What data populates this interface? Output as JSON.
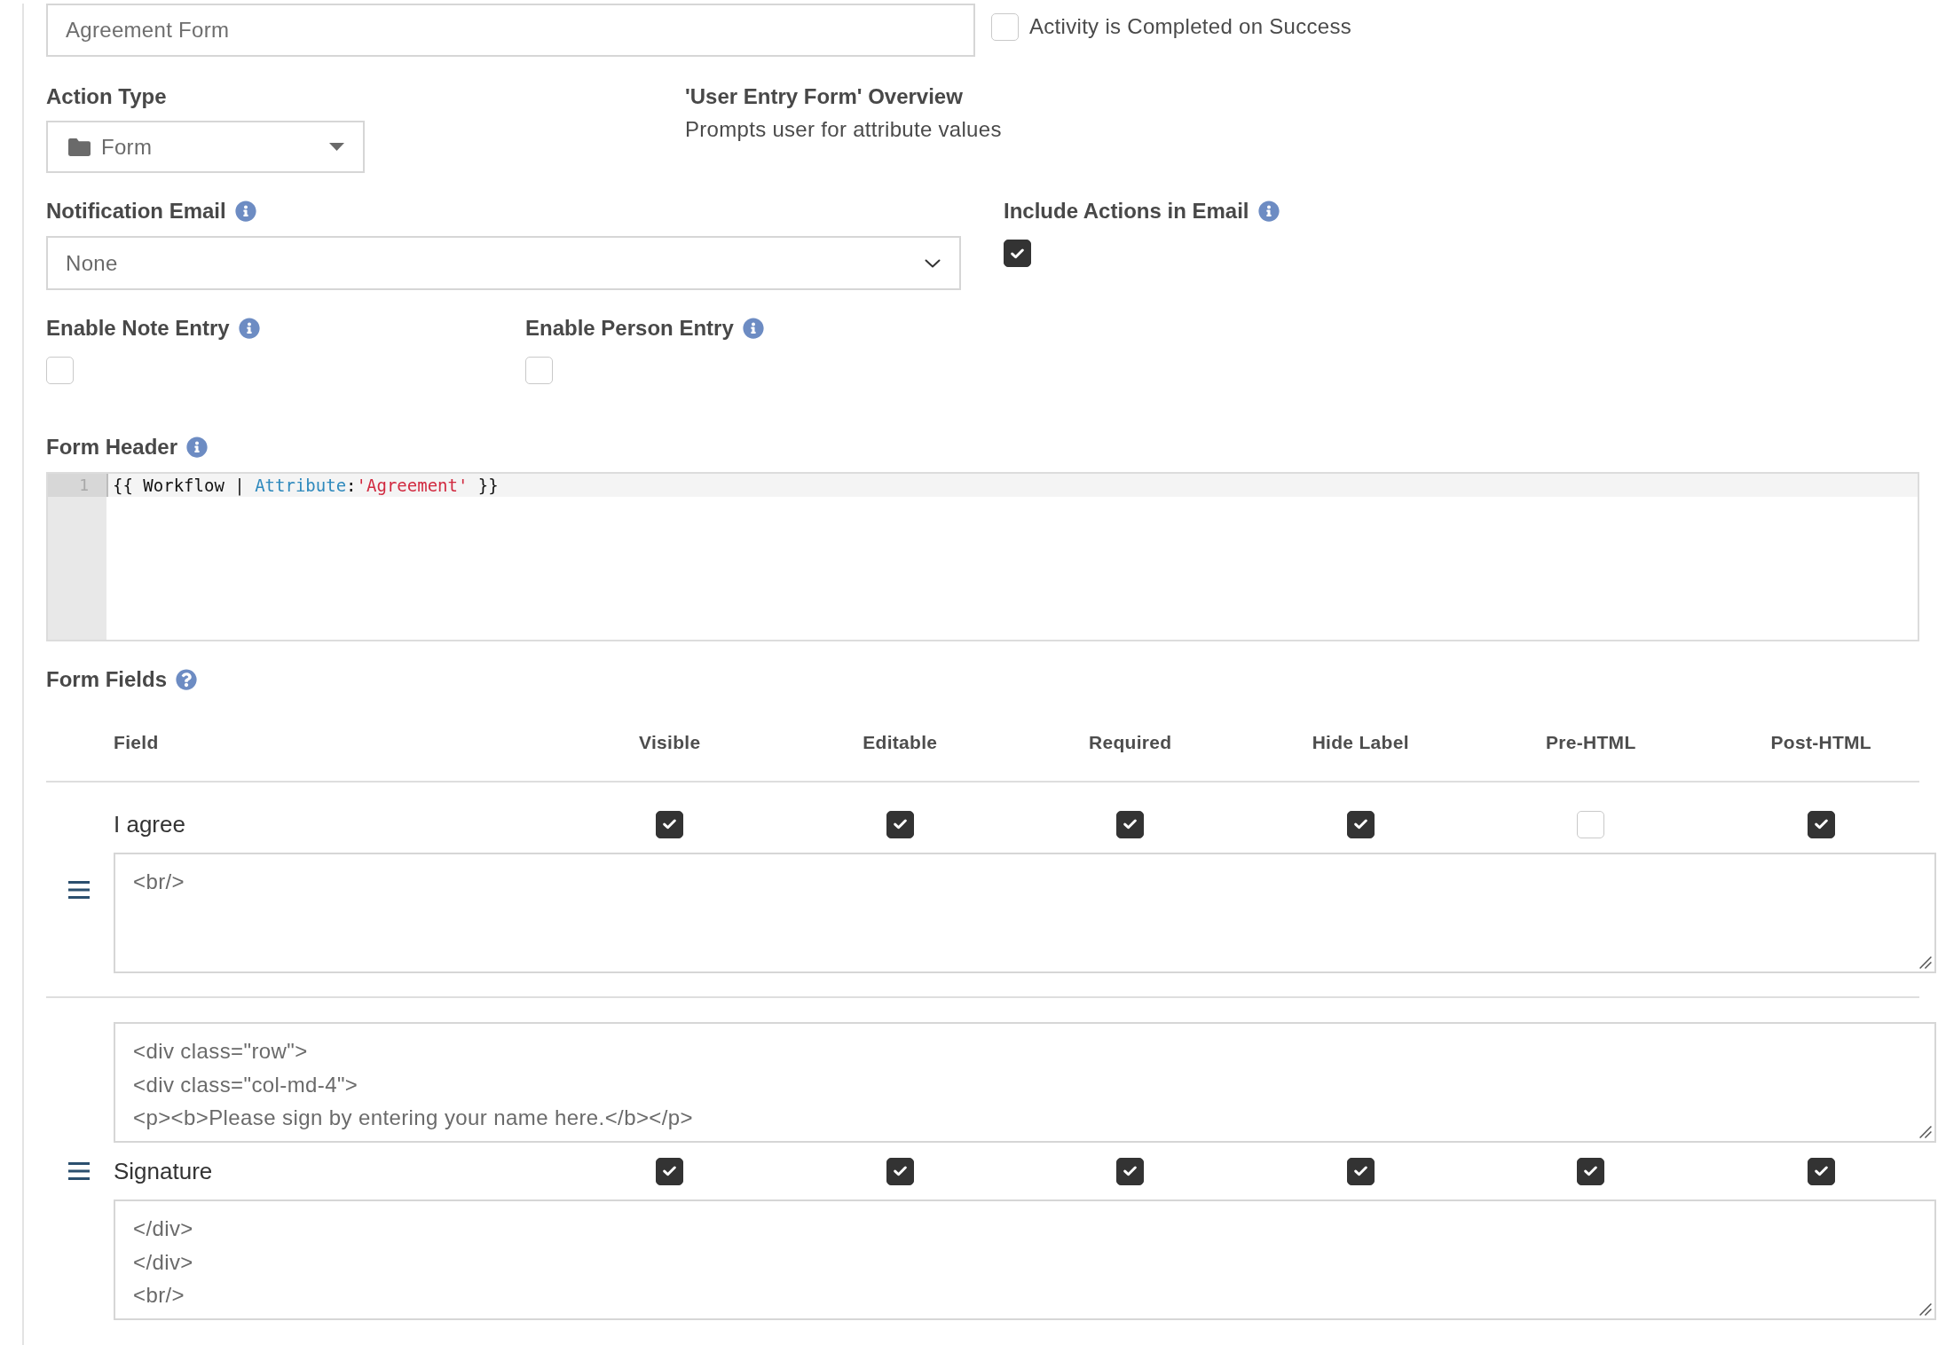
{
  "name_field": {
    "value": "Agreement Form"
  },
  "completed_on_success": {
    "label": "Activity is Completed on Success",
    "checked": false
  },
  "action_type": {
    "label": "Action Type",
    "value": "Form"
  },
  "overview": {
    "title": "'User Entry Form' Overview",
    "description": "Prompts user for attribute values"
  },
  "notification_email": {
    "label": "Notification Email",
    "value": "None"
  },
  "include_actions_in_email": {
    "label": "Include Actions in Email",
    "checked": true
  },
  "entry_options": [
    {
      "label": "Enable Note Entry",
      "checked": false
    },
    {
      "label": "Enable Person Entry",
      "checked": false
    }
  ],
  "form_header": {
    "label": "Form Header",
    "lines": [
      {
        "number": "1",
        "active": true,
        "tokens": [
          {
            "text": "{{ Workflow | ",
            "kind": "plain"
          },
          {
            "text": "Attribute",
            "kind": "filter"
          },
          {
            "text": ":",
            "kind": "plain"
          },
          {
            "text": "'Agreement'",
            "kind": "string"
          },
          {
            "text": " }}",
            "kind": "plain"
          }
        ]
      }
    ]
  },
  "form_fields": {
    "label": "Form Fields",
    "columns": [
      "Field",
      "Visible",
      "Editable",
      "Required",
      "Hide Label",
      "Pre-HTML",
      "Post-HTML"
    ],
    "rows": [
      {
        "field": "I agree",
        "checks": [
          {
            "checked": true
          },
          {
            "checked": true
          },
          {
            "checked": true
          },
          {
            "checked": true
          },
          {
            "checked": false
          },
          {
            "checked": true
          }
        ],
        "post_html": "<br/>"
      },
      {
        "field": "Signature",
        "checks": [
          {
            "checked": true
          },
          {
            "checked": true
          },
          {
            "checked": true
          },
          {
            "checked": true
          },
          {
            "checked": true
          },
          {
            "checked": true
          }
        ],
        "pre_html": "<div class=\"row\">\n<div class=\"col-md-4\">\n<p><b>Please sign by entering your name here.</b></p>",
        "post_html": "</div>\n</div>\n<br/>"
      }
    ]
  }
}
